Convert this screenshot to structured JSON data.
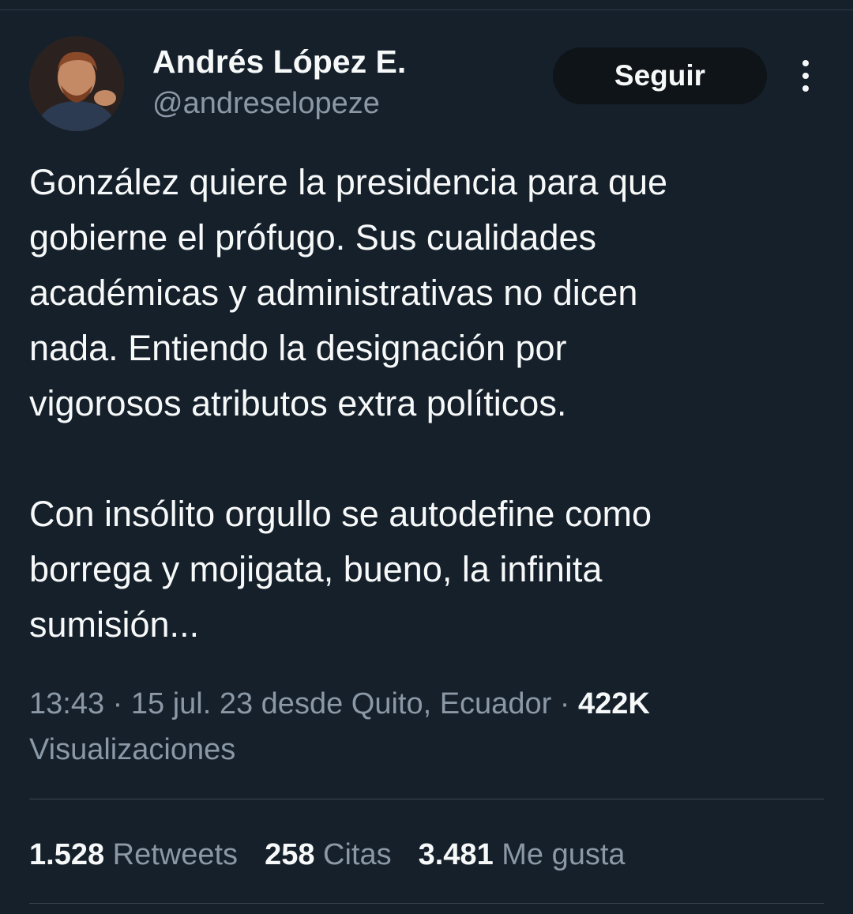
{
  "author": {
    "name": "Andrés López E.",
    "handle": "@andreselopeze"
  },
  "follow_button": {
    "label": "Seguir"
  },
  "tweet": {
    "text": "González quiere la presidencia para que\ngobierne el prófugo. Sus cualidades\nacadémicas y administrativas no dicen\nnada. Entiendo la designación por\nvigorosos atributos extra políticos.\n\nCon insólito orgullo se autodefine como\nborrega y mojigata, bueno, la infinita\nsumisión..."
  },
  "meta": {
    "time": "13:43",
    "date": "15 jul. 23",
    "location": "desde Quito, Ecuador",
    "views_count": "422K",
    "views_label": "Visualizaciones"
  },
  "stats": {
    "retweets_count": "1.528",
    "retweets_label": "Retweets",
    "quotes_count": "258",
    "quotes_label": "Citas",
    "likes_count": "3.481",
    "likes_label": "Me gusta"
  },
  "colors": {
    "background": "#15202b",
    "text_primary": "#f7f9f9",
    "text_secondary": "#8b98a5",
    "button_bg": "#0f1419",
    "divider": "#38444d"
  },
  "icons": {
    "more": "more-vertical-icon"
  }
}
